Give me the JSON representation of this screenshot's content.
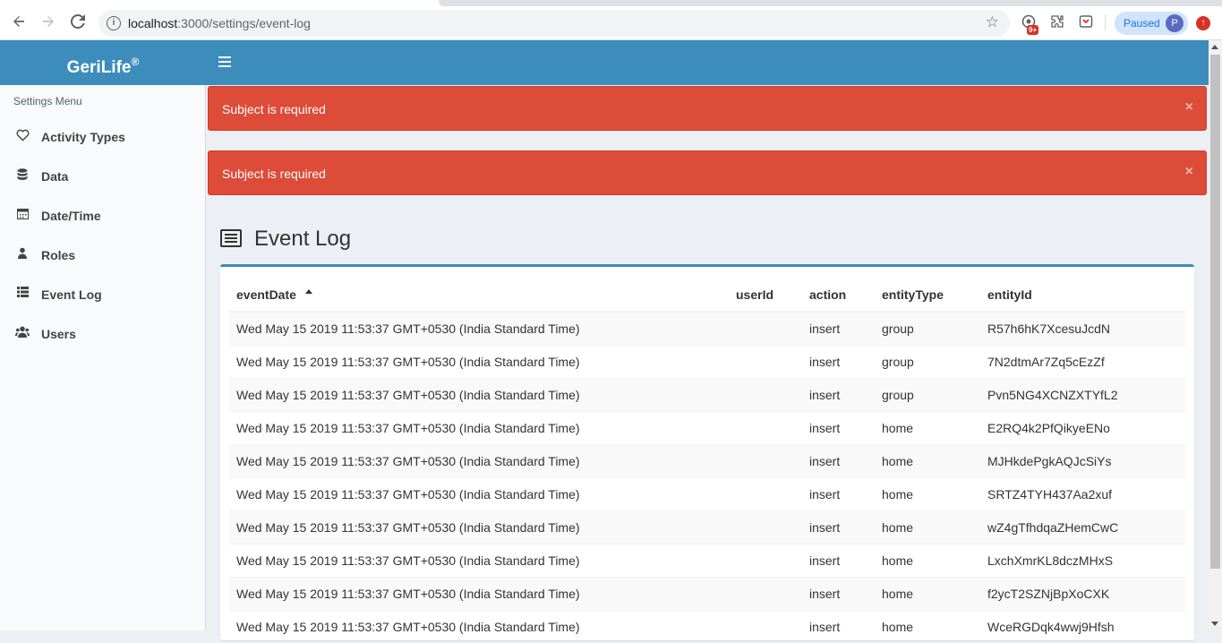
{
  "browser": {
    "url_host": "localhost",
    "url_path": ":3000/settings/event-log",
    "ext_badge": "9+",
    "profile_status": "Paused",
    "profile_initial": "P"
  },
  "app": {
    "brand": "GeriLife",
    "brand_mark": "®"
  },
  "sidebar": {
    "header": "Settings Menu",
    "items": [
      {
        "label": "Activity Types",
        "icon": "heart-outline-icon"
      },
      {
        "label": "Data",
        "icon": "database-icon"
      },
      {
        "label": "Date/Time",
        "icon": "calendar-icon"
      },
      {
        "label": "Roles",
        "icon": "user-roles-icon"
      },
      {
        "label": "Event Log",
        "icon": "list-icon"
      },
      {
        "label": "Users",
        "icon": "users-icon"
      }
    ]
  },
  "alerts": [
    {
      "text": "Subject is required",
      "close": "×"
    },
    {
      "text": "Subject is required",
      "close": "×"
    }
  ],
  "page": {
    "title": "Event Log"
  },
  "table": {
    "columns": [
      "eventDate",
      "userId",
      "action",
      "entityType",
      "entityId"
    ],
    "sorted_column": "eventDate",
    "sort_direction": "ascending",
    "rows": [
      [
        "Wed May 15 2019 11:53:37 GMT+0530 (India Standard Time)",
        "",
        "insert",
        "group",
        "R57h6hK7XcesuJcdN"
      ],
      [
        "Wed May 15 2019 11:53:37 GMT+0530 (India Standard Time)",
        "",
        "insert",
        "group",
        "7N2dtmAr7Zq5cEzZf"
      ],
      [
        "Wed May 15 2019 11:53:37 GMT+0530 (India Standard Time)",
        "",
        "insert",
        "group",
        "Pvn5NG4XCNZXTYfL2"
      ],
      [
        "Wed May 15 2019 11:53:37 GMT+0530 (India Standard Time)",
        "",
        "insert",
        "home",
        "E2RQ4k2PfQikyeENo"
      ],
      [
        "Wed May 15 2019 11:53:37 GMT+0530 (India Standard Time)",
        "",
        "insert",
        "home",
        "MJHkdePgkAQJcSiYs"
      ],
      [
        "Wed May 15 2019 11:53:37 GMT+0530 (India Standard Time)",
        "",
        "insert",
        "home",
        "SRTZ4TYH437Aa2xuf"
      ],
      [
        "Wed May 15 2019 11:53:37 GMT+0530 (India Standard Time)",
        "",
        "insert",
        "home",
        "wZ4gTfhdqaZHemCwC"
      ],
      [
        "Wed May 15 2019 11:53:37 GMT+0530 (India Standard Time)",
        "",
        "insert",
        "home",
        "LxchXmrKL8dczMHxS"
      ],
      [
        "Wed May 15 2019 11:53:37 GMT+0530 (India Standard Time)",
        "",
        "insert",
        "home",
        "f2ycT2SZNjBpXoCXK"
      ],
      [
        "Wed May 15 2019 11:53:37 GMT+0530 (India Standard Time)",
        "",
        "insert",
        "home",
        "WceRGDqk4wwj9Hfsh"
      ]
    ]
  },
  "colors": {
    "header": "#3c8dbc",
    "alert": "#dd4b39",
    "sidebar": "#f9fafc"
  }
}
